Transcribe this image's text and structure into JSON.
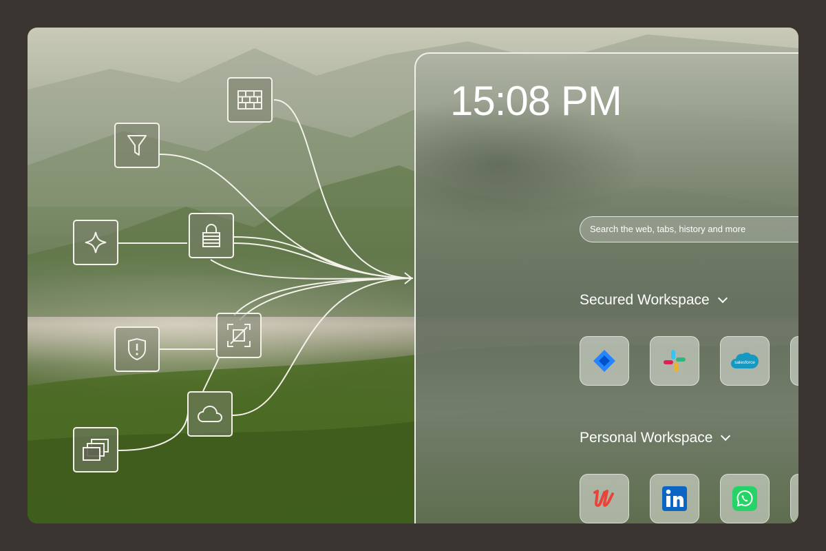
{
  "clock": {
    "time": "15:08 PM"
  },
  "search": {
    "placeholder": "Search the web, tabs, history and more"
  },
  "workspaces": [
    {
      "title": "Secured Workspace",
      "apps": [
        "jira-icon",
        "slack-icon",
        "salesforce-icon"
      ],
      "salesforce_text": "salesforce"
    },
    {
      "title": "Personal Workspace",
      "apps": [
        "udemy-icon",
        "linkedin-icon",
        "whatsapp-icon"
      ]
    }
  ],
  "colors": {
    "frame": "#3a3530",
    "line": "#f4f2ea",
    "jira": "#2684ff",
    "linkedin": "#0a66c2",
    "whatsapp": "#25d366",
    "udemy": "#e8443a",
    "salesforce": "#1798c1"
  },
  "nodes": [
    "firewall-icon",
    "filter-icon",
    "sparkle-icon",
    "lock-icon",
    "shield-alert-icon",
    "scan-icon",
    "cloud-icon",
    "windows-stack-icon"
  ]
}
